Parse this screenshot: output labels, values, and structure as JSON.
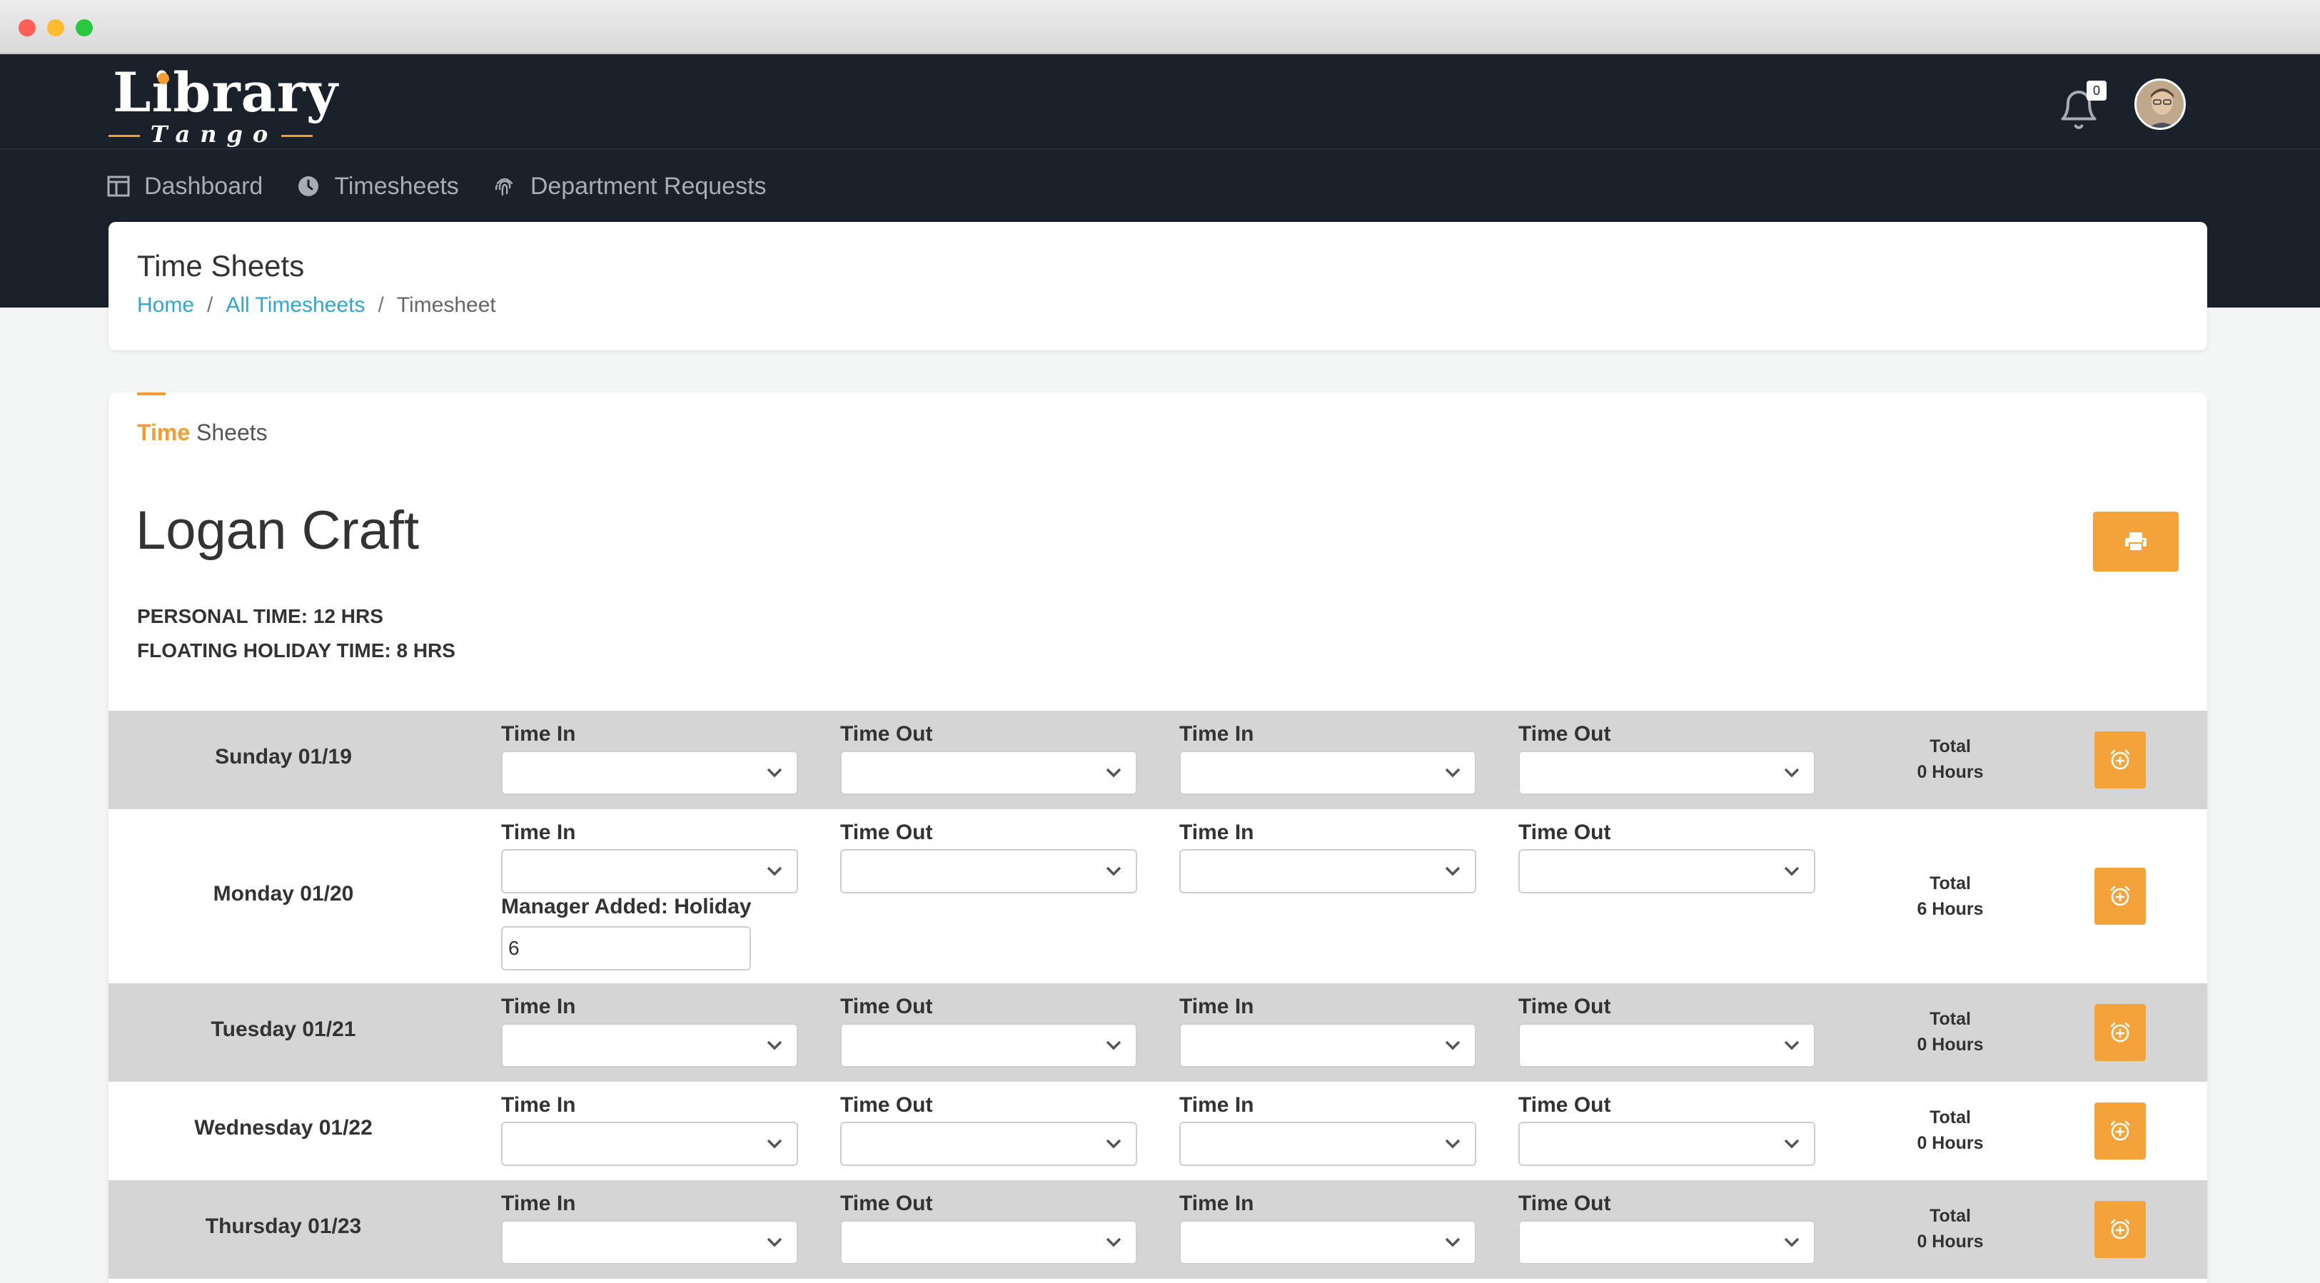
{
  "window": {
    "traffic_lights": [
      "close",
      "minimize",
      "zoom"
    ]
  },
  "logo": {
    "main": "Library",
    "sub": "Tango"
  },
  "notifications": {
    "count": "0"
  },
  "colors": {
    "accent": "#f3a33a",
    "header_bg": "#1b212b",
    "link": "#2ea6d6",
    "row_shade": "#d5d5d5"
  },
  "nav": {
    "items": [
      {
        "label": "Dashboard",
        "icon": "dashboard-icon"
      },
      {
        "label": "Timesheets",
        "icon": "clock-icon"
      },
      {
        "label": "Department Requests",
        "icon": "fingerprint-icon"
      }
    ]
  },
  "page": {
    "title": "Time Sheets",
    "breadcrumb": [
      "Home",
      "All Timesheets",
      "Timesheet"
    ]
  },
  "section": {
    "title_highlight": "Time",
    "title_rest": " Sheets"
  },
  "employee": {
    "name": "Logan Craft",
    "personal_time": "PERSONAL TIME: 12 HRS",
    "floating_holiday": "FLOATING HOLIDAY TIME: 8 HRS"
  },
  "days": [
    {
      "label": "Sunday 01/19",
      "slots": [
        "Time In",
        "Time Out",
        "Time In",
        "Time Out"
      ],
      "total_label": "Total",
      "total_value": "0 Hours"
    },
    {
      "label": "Monday 01/20",
      "slots": [
        "Time In",
        "Time Out",
        "Time In",
        "Time Out"
      ],
      "extra_label": "Manager Added: Holiday",
      "extra_value": "6",
      "total_label": "Total",
      "total_value": "6 Hours"
    },
    {
      "label": "Tuesday 01/21",
      "slots": [
        "Time In",
        "Time Out",
        "Time In",
        "Time Out"
      ],
      "total_label": "Total",
      "total_value": "0 Hours"
    },
    {
      "label": "Wednesday 01/22",
      "slots": [
        "Time In",
        "Time Out",
        "Time In",
        "Time Out"
      ],
      "total_label": "Total",
      "total_value": "0 Hours"
    },
    {
      "label": "Thursday 01/23",
      "slots": [
        "Time In",
        "Time Out",
        "Time In",
        "Time Out"
      ],
      "total_label": "Total",
      "total_value": "0 Hours"
    }
  ]
}
